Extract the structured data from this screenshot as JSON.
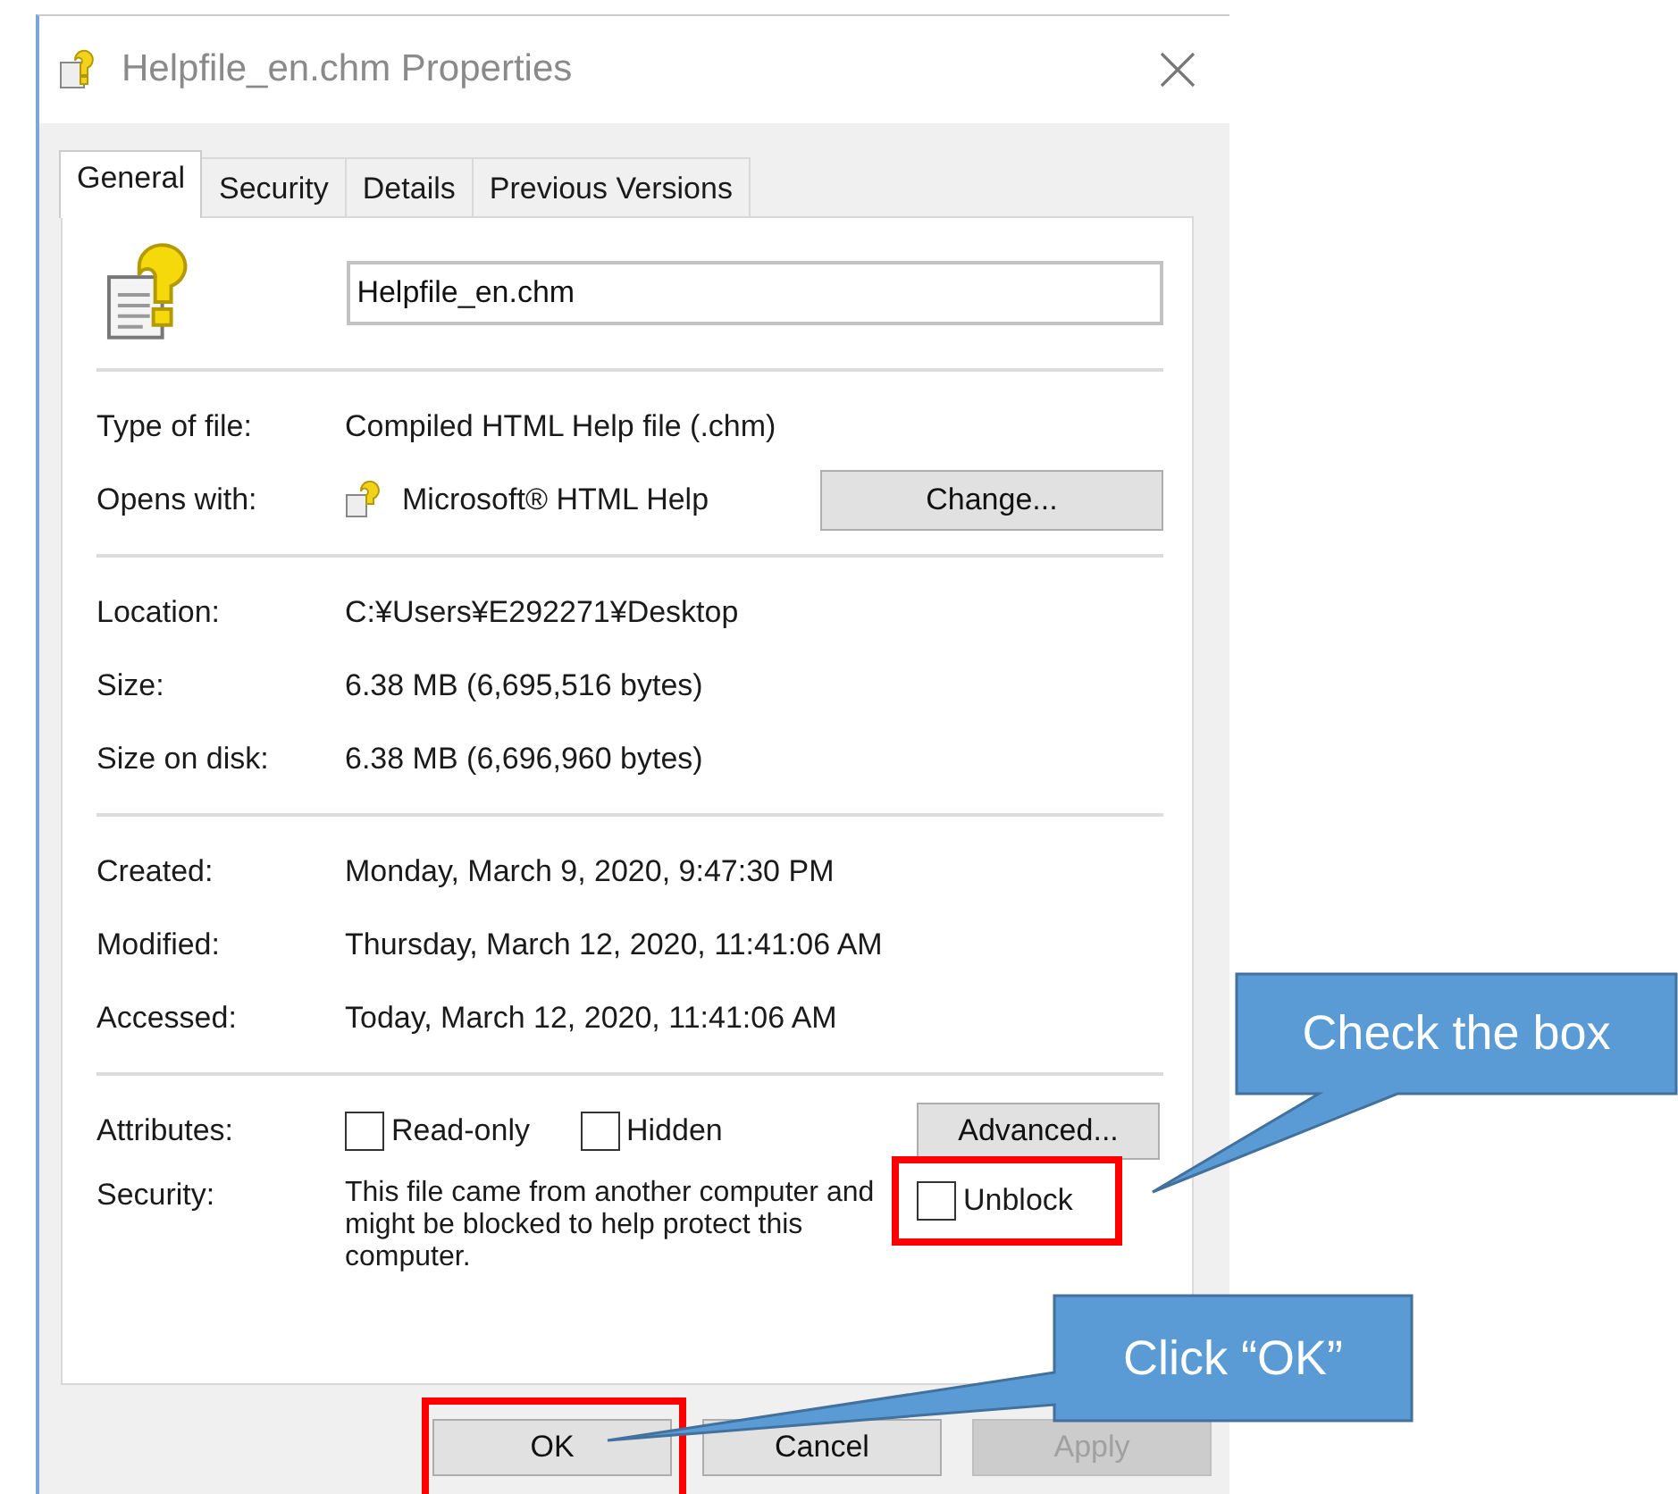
{
  "window": {
    "title": "Helpfile_en.chm Properties"
  },
  "tabs": [
    {
      "label": "General",
      "selected": true
    },
    {
      "label": "Security",
      "selected": false
    },
    {
      "label": "Details",
      "selected": false
    },
    {
      "label": "Previous Versions",
      "selected": false
    }
  ],
  "file_name": {
    "value": "Helpfile_en.chm"
  },
  "sections": [
    {
      "rows": [
        {
          "kind": "text",
          "label": "Type of file:",
          "value": "Compiled HTML Help file (.chm)"
        },
        {
          "kind": "app",
          "label": "Opens with:",
          "value": "Microsoft® HTML Help",
          "button": "Change..."
        }
      ]
    },
    {
      "rows": [
        {
          "kind": "text",
          "label": "Location:",
          "value": "C:¥Users¥E292271¥Desktop"
        },
        {
          "kind": "text",
          "label": "Size:",
          "value": "6.38 MB (6,695,516 bytes)"
        },
        {
          "kind": "text",
          "label": "Size on disk:",
          "value": "6.38 MB (6,696,960 bytes)"
        }
      ]
    },
    {
      "rows": [
        {
          "kind": "text",
          "label": "Created:",
          "value": "Monday, March 9, 2020, 9:47:30 PM"
        },
        {
          "kind": "text",
          "label": "Modified:",
          "value": "Thursday, March 12, 2020, 11:41:06 AM"
        },
        {
          "kind": "text",
          "label": "Accessed:",
          "value": "Today, March 12, 2020, 11:41:06 AM"
        }
      ]
    },
    {
      "rows": [
        {
          "kind": "attributes",
          "label": "Attributes:",
          "checkboxes": [
            {
              "label": "Read-only",
              "checked": false
            },
            {
              "label": "Hidden",
              "checked": false
            }
          ],
          "button": "Advanced..."
        },
        {
          "kind": "security",
          "label": "Security:",
          "value": "This file came from another computer and might be blocked to help protect this computer.",
          "checkbox": {
            "label": "Unblock",
            "checked": false,
            "highlighted": true
          }
        }
      ]
    }
  ],
  "buttons": [
    {
      "label": "OK",
      "disabled": false,
      "highlighted": true
    },
    {
      "label": "Cancel",
      "disabled": false,
      "highlighted": false
    },
    {
      "label": "Apply",
      "disabled": true,
      "highlighted": false
    }
  ],
  "callouts": [
    {
      "text": "Check the box"
    },
    {
      "text": "Click “OK”"
    }
  ]
}
